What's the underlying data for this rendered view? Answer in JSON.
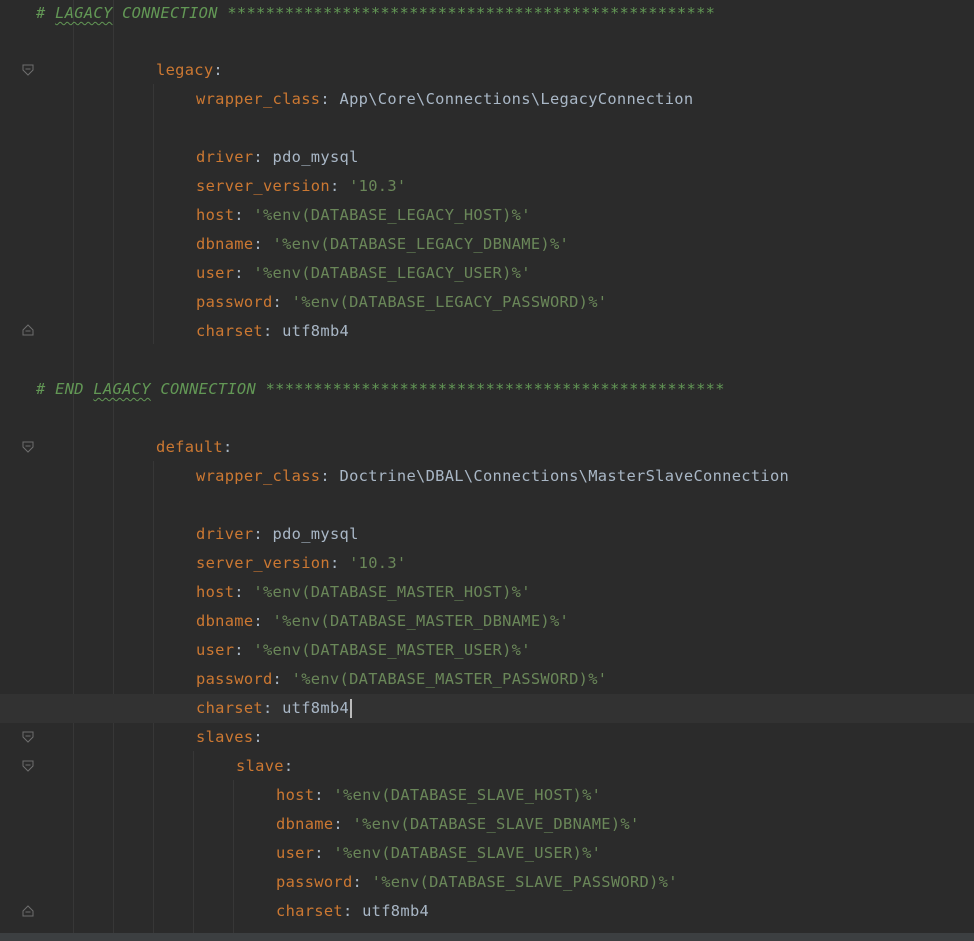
{
  "editor": {
    "header_comment": {
      "prefix": "# ",
      "typo": "LAGACY",
      "rest": " CONNECTION ***************************************************"
    },
    "legacy_block": {
      "name": "legacy",
      "wrapper_class_key": "wrapper_class",
      "wrapper_class_value": "App\\Core\\Connections\\LegacyConnection",
      "driver_key": "driver",
      "driver_value": "pdo_mysql",
      "server_version_key": "server_version",
      "server_version_value": "'10.3'",
      "host_key": "host",
      "host_value": "'%env(DATABASE_LEGACY_HOST)%'",
      "dbname_key": "dbname",
      "dbname_value": "'%env(DATABASE_LEGACY_DBNAME)%'",
      "user_key": "user",
      "user_value": "'%env(DATABASE_LEGACY_USER)%'",
      "password_key": "password",
      "password_value": "'%env(DATABASE_LEGACY_PASSWORD)%'",
      "charset_key": "charset",
      "charset_value": "utf8mb4"
    },
    "end_comment": {
      "prefix": "# END ",
      "typo": "LAGACY",
      "rest": " CONNECTION ************************************************"
    },
    "default_block": {
      "name": "default",
      "wrapper_class_key": "wrapper_class",
      "wrapper_class_value": "Doctrine\\DBAL\\Connections\\MasterSlaveConnection",
      "driver_key": "driver",
      "driver_value": "pdo_mysql",
      "server_version_key": "server_version",
      "server_version_value": "'10.3'",
      "host_key": "host",
      "host_value": "'%env(DATABASE_MASTER_HOST)%'",
      "dbname_key": "dbname",
      "dbname_value": "'%env(DATABASE_MASTER_DBNAME)%'",
      "user_key": "user",
      "user_value": "'%env(DATABASE_MASTER_USER)%'",
      "password_key": "password",
      "password_value": "'%env(DATABASE_MASTER_PASSWORD)%'",
      "charset_key": "charset",
      "charset_value": "utf8mb4",
      "slaves_key": "slaves",
      "slave_key": "slave",
      "slave_host_key": "host",
      "slave_host_value": "'%env(DATABASE_SLAVE_HOST)%'",
      "slave_dbname_key": "dbname",
      "slave_dbname_value": "'%env(DATABASE_SLAVE_DBNAME)%'",
      "slave_user_key": "user",
      "slave_user_value": "'%env(DATABASE_SLAVE_USER)%'",
      "slave_password_key": "password",
      "slave_password_value": "'%env(DATABASE_SLAVE_PASSWORD)%'",
      "slave_charset_key": "charset",
      "slave_charset_value": "utf8mb4"
    },
    "colors": {
      "background": "#2b2b2b",
      "key": "#cc7832",
      "string": "#6a8759",
      "plain": "#a9b7c6",
      "comment": "#629755",
      "current_line": "#323232"
    }
  }
}
